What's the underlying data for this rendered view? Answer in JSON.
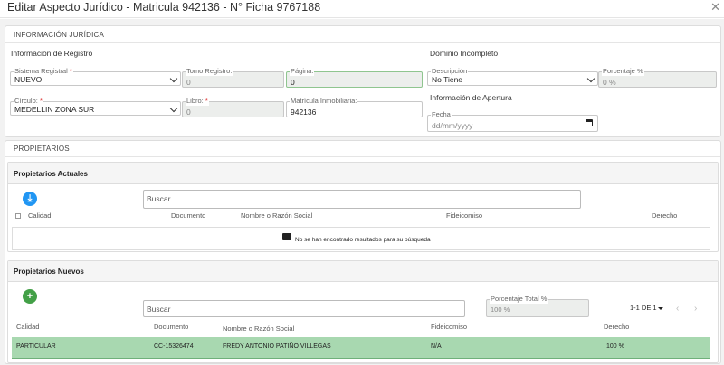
{
  "modal": {
    "title": "Editar Aspecto Jurídico - Matricula 942136 - N° Ficha 9767188",
    "close_icon": "close-icon"
  },
  "info": {
    "section_title": "INFORMACIÓN JURÍDICA",
    "registro_heading": "Información de Registro",
    "sistema_registral": {
      "label": "Sistema Registral",
      "value": "NUEVO"
    },
    "tomo_registro": {
      "label": "Tomo Registro:",
      "value": "0"
    },
    "pagina": {
      "label": "Página:",
      "value": "0"
    },
    "circulo": {
      "label": "Círculo:",
      "value": "MEDELLIN ZONA SUR"
    },
    "libro": {
      "label": "Libro:",
      "value": "0"
    },
    "matricula": {
      "label": "Matrícula Inmobiliaria:",
      "value": "942136"
    },
    "dominio_heading": "Dominio Incompleto",
    "descripcion": {
      "label": "Descripción",
      "value": "No Tiene"
    },
    "porcentaje": {
      "label": "Porcentaje %",
      "value": "0 %"
    },
    "apertura_heading": "Información de Apertura",
    "fecha": {
      "label": "Fecha",
      "placeholder": "dd/mm/yyyy"
    },
    "required_mark": "*"
  },
  "propietarios": {
    "section_title": "PROPIETARIOS",
    "actuales": {
      "title": "Propietarios Actuales",
      "search_placeholder": "Buscar",
      "columns": [
        "Calidad",
        "Documento",
        "Nombre o Razón Social",
        "Fideicomiso",
        "Derecho"
      ],
      "empty_message": "No se han encontrado resultados para su búsqueda"
    },
    "nuevos": {
      "title": "Propietarios Nuevos",
      "search_placeholder": "Buscar",
      "porcentaje_total": {
        "label": "Porcentaje Total %",
        "value": "100 %"
      },
      "pager": "1-1 DE 1",
      "columns": [
        "Calidad",
        "Documento",
        "Nombre o Razón Social",
        "Fideicomiso",
        "Derecho"
      ],
      "rows": [
        {
          "calidad": "PARTICULAR",
          "documento": "CC-15326474",
          "nombre": "FREDY ANTONIO PATIÑO VILLEGAS",
          "fideicomiso": "N/A",
          "derecho": "100 %"
        }
      ]
    }
  },
  "colors": {
    "accent_blue": "#2196f3",
    "accent_green": "#43a047",
    "row_green": "#a8d8b0"
  }
}
